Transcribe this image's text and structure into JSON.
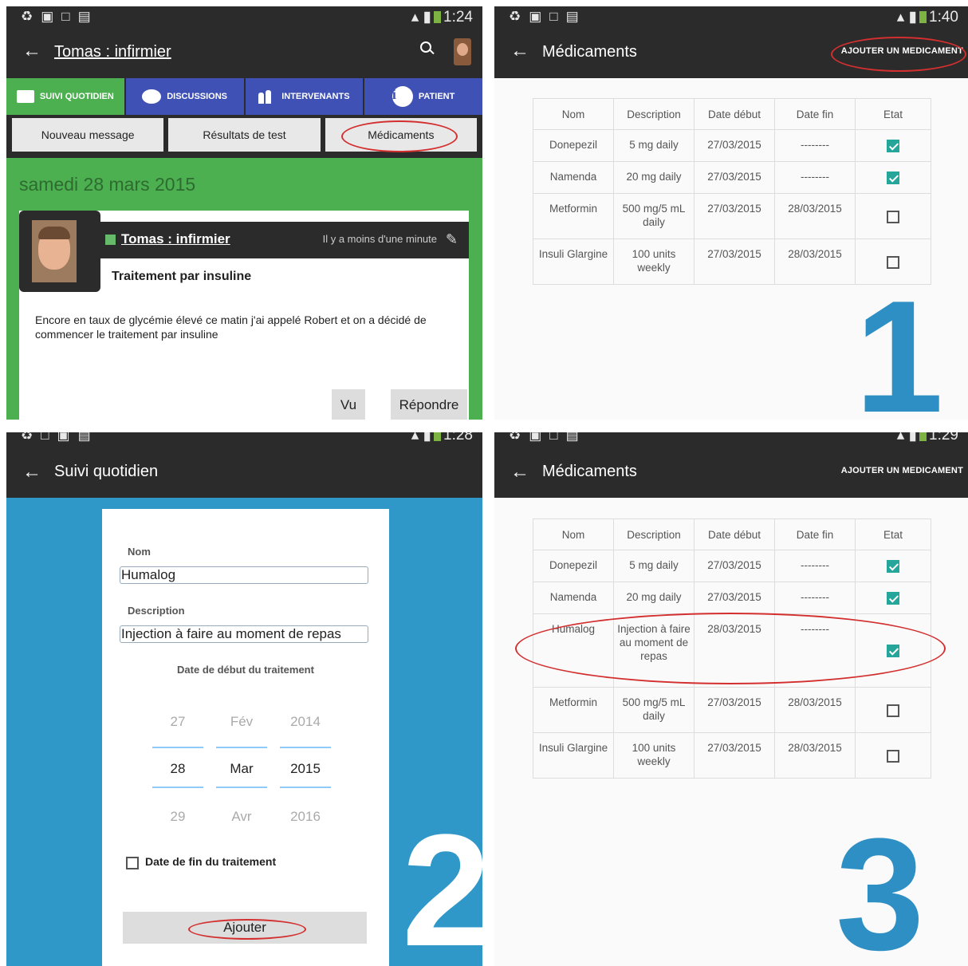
{
  "panel1": {
    "status": {
      "time": "1:24"
    },
    "appbar": {
      "title": "Tomas : infirmier"
    },
    "tabs": [
      {
        "label": "SUIVI QUOTIDIEN"
      },
      {
        "label": "DISCUSSIONS"
      },
      {
        "label": "INTERVENANTS"
      },
      {
        "label": "PATIENT"
      }
    ],
    "subbuttons": [
      {
        "label": "Nouveau message"
      },
      {
        "label": "Résultats de test"
      },
      {
        "label": "Médicaments"
      }
    ],
    "date": "samedi 28 mars 2015",
    "post": {
      "author": "Tomas : infirmier",
      "ago": "Il y a moins d'une minute",
      "title": "Traitement par insuline",
      "body": "Encore en taux de glycémie élevé ce matin j'ai appelé Robert et on a décidé de commencer le traitement par insuline",
      "seen_label": "Vu",
      "reply_label": "Répondre"
    }
  },
  "panel2": {
    "status": {
      "time": "1:40"
    },
    "appbar": {
      "title": "Médicaments",
      "action": "AJOUTER UN MEDICAMENT"
    },
    "columns": [
      "Nom",
      "Description",
      "Date début",
      "Date fin",
      "Etat"
    ],
    "rows": [
      {
        "name": "Donepezil",
        "desc": "5 mg daily",
        "start": "27/03/2015",
        "end": "--------",
        "active": true
      },
      {
        "name": "Namenda",
        "desc": "20 mg daily",
        "start": "27/03/2015",
        "end": "--------",
        "active": true
      },
      {
        "name": "Metformin",
        "desc": "500 mg/5 mL daily",
        "start": "27/03/2015",
        "end": "28/03/2015",
        "active": false
      },
      {
        "name": "Insuli Glargine",
        "desc": "100 units weekly",
        "start": "27/03/2015",
        "end": "28/03/2015",
        "active": false
      }
    ],
    "step": "1"
  },
  "panel3": {
    "status": {
      "time": "1:28"
    },
    "appbar": {
      "title": "Suivi quotidien"
    },
    "form": {
      "name_label": "Nom",
      "name_value": "Humalog",
      "desc_label": "Description",
      "desc_value": "Injection à faire au moment de repas",
      "start_label": "Date de début du traitement",
      "picker": {
        "prev": [
          "27",
          "Fév",
          "2014"
        ],
        "current": [
          "28",
          "Mar",
          "2015"
        ],
        "next": [
          "29",
          "Avr",
          "2016"
        ]
      },
      "end_label": "Date de fin du traitement",
      "submit_label": "Ajouter"
    },
    "step": "2"
  },
  "panel4": {
    "status": {
      "time": "1:29"
    },
    "appbar": {
      "title": "Médicaments",
      "action": "AJOUTER UN MEDICAMENT"
    },
    "columns": [
      "Nom",
      "Description",
      "Date début",
      "Date fin",
      "Etat"
    ],
    "rows": [
      {
        "name": "Donepezil",
        "desc": "5 mg daily",
        "start": "27/03/2015",
        "end": "--------",
        "active": true
      },
      {
        "name": "Namenda",
        "desc": "20 mg daily",
        "start": "27/03/2015",
        "end": "--------",
        "active": true
      },
      {
        "name": "Humalog",
        "desc": "Injection à faire au moment de repas",
        "start": "28/03/2015",
        "end": "--------",
        "active": true
      },
      {
        "name": "Metformin",
        "desc": "500 mg/5 mL daily",
        "start": "27/03/2015",
        "end": "28/03/2015",
        "active": false
      },
      {
        "name": "Insuli Glargine",
        "desc": "100 units weekly",
        "start": "27/03/2015",
        "end": "28/03/2015",
        "active": false
      }
    ],
    "step": "3"
  },
  "colors": {
    "appbar": "#2b2b2b",
    "green": "#4caf50",
    "tab_blue": "#3f51b5",
    "step_blue": "#2e8fc4",
    "check_teal": "#26a69a",
    "highlight_red": "#d32f2f"
  }
}
